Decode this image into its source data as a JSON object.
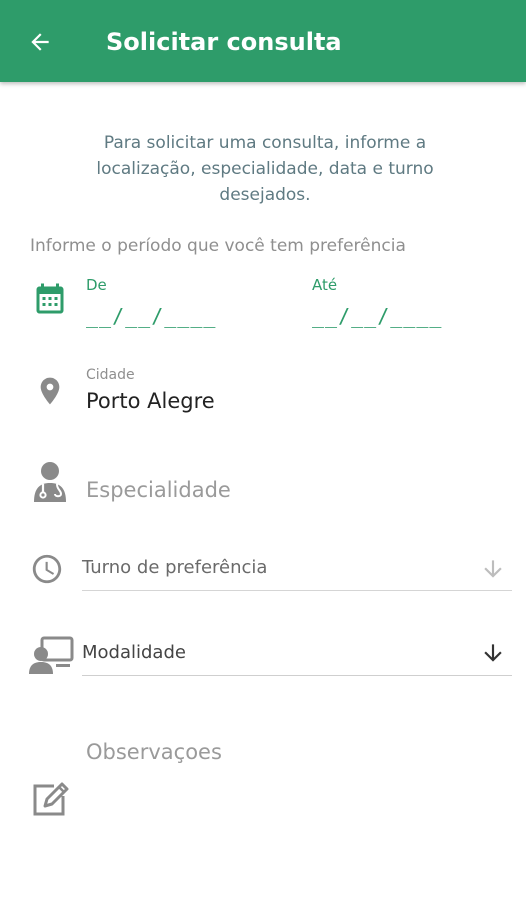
{
  "app_bar": {
    "title": "Solicitar consulta",
    "back_icon": "arrow-back-icon",
    "background": "#2e9c6a"
  },
  "intro": {
    "text": "Para solicitar uma consulta, informe a localização, especialidade, data e turno desejados."
  },
  "period": {
    "label": "Informe o período que você tem preferência",
    "icon": "calendar-icon",
    "from_label": "De",
    "from_value": "__/__/____",
    "to_label": "Até",
    "to_value": "__/__/____"
  },
  "cidade": {
    "icon": "location-pin-icon",
    "label": "Cidade",
    "value": "Porto Alegre"
  },
  "especialidade": {
    "icon": "doctor-icon",
    "placeholder": "Especialidade"
  },
  "turno": {
    "icon": "clock-icon",
    "label": "Turno de preferência",
    "arrow_icon": "arrow-down-icon"
  },
  "modalidade": {
    "icon": "teleconsult-icon",
    "label": "Modalidade",
    "arrow_icon": "arrow-down-icon"
  },
  "observacoes": {
    "label": "Observaçoes",
    "icon": "edit-icon"
  },
  "colors": {
    "primary": "#2e9c6a",
    "intro_text": "#5f7a82",
    "icon_gray": "#8a8a8a"
  }
}
